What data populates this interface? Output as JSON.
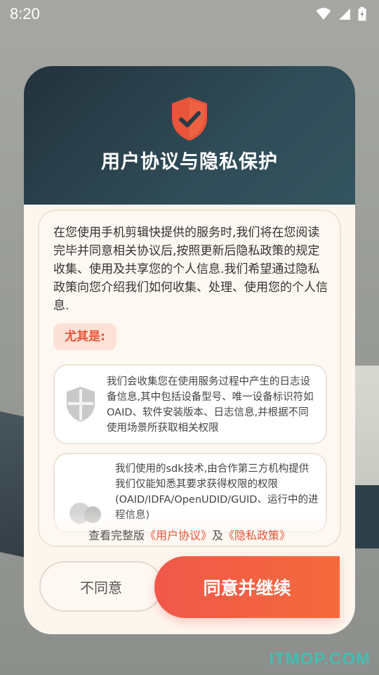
{
  "status_bar": {
    "time": "8:20",
    "icons": [
      "wifi-icon",
      "cellular-icon",
      "battery-icon"
    ]
  },
  "dialog": {
    "title": "用户协议与隐私保护",
    "icon": "shield-check-icon",
    "intro": "在您使用手机剪辑快提供的服务时,我们将在您阅读完毕并同意相关协议后,按照更新后隐私政策的规定收集、使用及共享您的个人信息.我们希望通过隐私政策向您介绍我们如何收集、处理、使用您的个人信息.",
    "highlight_label": "尤其是:",
    "cards": [
      {
        "icon": "shield-icon",
        "text": "我们会收集您在使用服务过程中产生的日志设备信息,其中包括设备型号、唯一设备标识符如OAID、软件安装版本、日志信息,并根据不同使用场景所获取相关权限"
      },
      {
        "icon": "sdk-icon",
        "text": "我们使用的sdk技术,由合作第三方机构提供我们仅能知悉其要求获得权限的权限(OAID/IDFA/OpenUDID/GUID、运行中的进程信息)"
      }
    ],
    "agreement": {
      "prefix": "查看完整版",
      "user_agreement": "《用户协议》",
      "connector": "及",
      "privacy_policy": "《隐私政策》"
    },
    "buttons": {
      "disagree": "不同意",
      "agree": "同意并继续"
    }
  },
  "watermark": "ITMOP.COM",
  "colors": {
    "accent": "#e8553a",
    "header_dark": "#23323c",
    "agree_button": "#f0584a"
  }
}
